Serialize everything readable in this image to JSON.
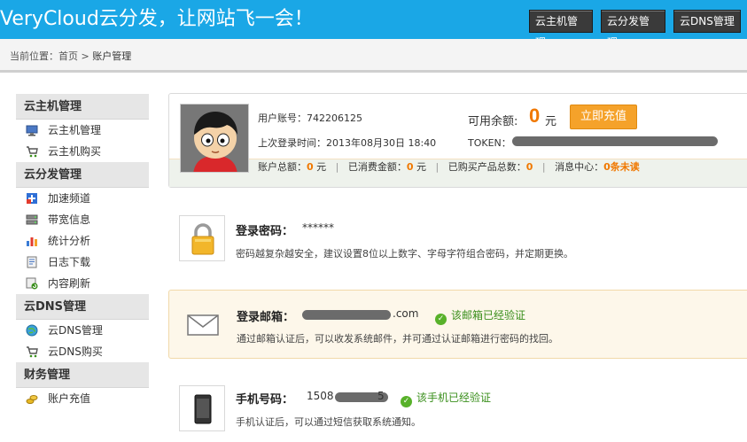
{
  "header": {
    "logo": "VeryCloud云分发，让网站飞一会！",
    "nav": [
      "云主机管理",
      "云分发管理",
      "云DNS管理"
    ]
  },
  "breadcrumb": {
    "prefix": "当前位置：",
    "home": "首页",
    "separator": " > ",
    "current": "账户管理"
  },
  "sidebar": {
    "sections": [
      {
        "title": "云主机管理",
        "items": [
          {
            "label": "云主机管理",
            "icon": "monitor-icon"
          },
          {
            "label": "云主机购买",
            "icon": "cart-icon"
          }
        ]
      },
      {
        "title": "云分发管理",
        "items": [
          {
            "label": "加速频道",
            "icon": "accelerate-icon"
          },
          {
            "label": "带宽信息",
            "icon": "bandwidth-icon"
          },
          {
            "label": "统计分析",
            "icon": "bar-chart-icon"
          },
          {
            "label": "日志下载",
            "icon": "log-icon"
          },
          {
            "label": "内容刷新",
            "icon": "refresh-icon"
          }
        ]
      },
      {
        "title": "云DNS管理",
        "items": [
          {
            "label": "云DNS管理",
            "icon": "globe-icon"
          },
          {
            "label": "云DNS购买",
            "icon": "cart-icon"
          }
        ]
      },
      {
        "title": "财务管理",
        "items": [
          {
            "label": "账户充值",
            "icon": "coins-icon"
          }
        ]
      }
    ]
  },
  "account": {
    "user_label": "用户账号：",
    "user_id": "742206125",
    "last_login_label": "上次登录时间：",
    "last_login": "2013年08月30日 18:40",
    "balance_label": "可用余额:",
    "balance": "0",
    "balance_unit": "元",
    "recharge_button": "立即充值",
    "token_label": "TOKEN：",
    "stats": {
      "total_label": "账户总额：",
      "total": "0",
      "total_unit": "元",
      "spent_label": "已消费金额：",
      "spent": "0",
      "spent_unit": "元",
      "products_label": "已购买产品总数：",
      "products": "0",
      "messages_label": "消息中心：",
      "messages": "0条未读"
    }
  },
  "security": {
    "password": {
      "title": "登录密码：",
      "value": "******",
      "desc": "密码越复杂越安全，建议设置8位以上数字、字母字符组合密码，并定期更换。"
    },
    "email": {
      "title": "登录邮箱：",
      "value_suffix": ".com",
      "verified": "该邮箱已经验证",
      "desc": "通过邮箱认证后，可以收发系统邮件，并可通过认证邮箱进行密码的找回。"
    },
    "phone": {
      "title": "手机号码：",
      "value_prefix": "1508",
      "value_suffix": "5",
      "verified": "该手机已经验证",
      "desc": "手机认证后，可以通过短信获取系统通知。"
    }
  },
  "colors": {
    "header_bg": "#1aa7e6",
    "accent_orange": "#f07800",
    "button_orange": "#f5a22a",
    "verified_green": "#3a8f1c"
  }
}
